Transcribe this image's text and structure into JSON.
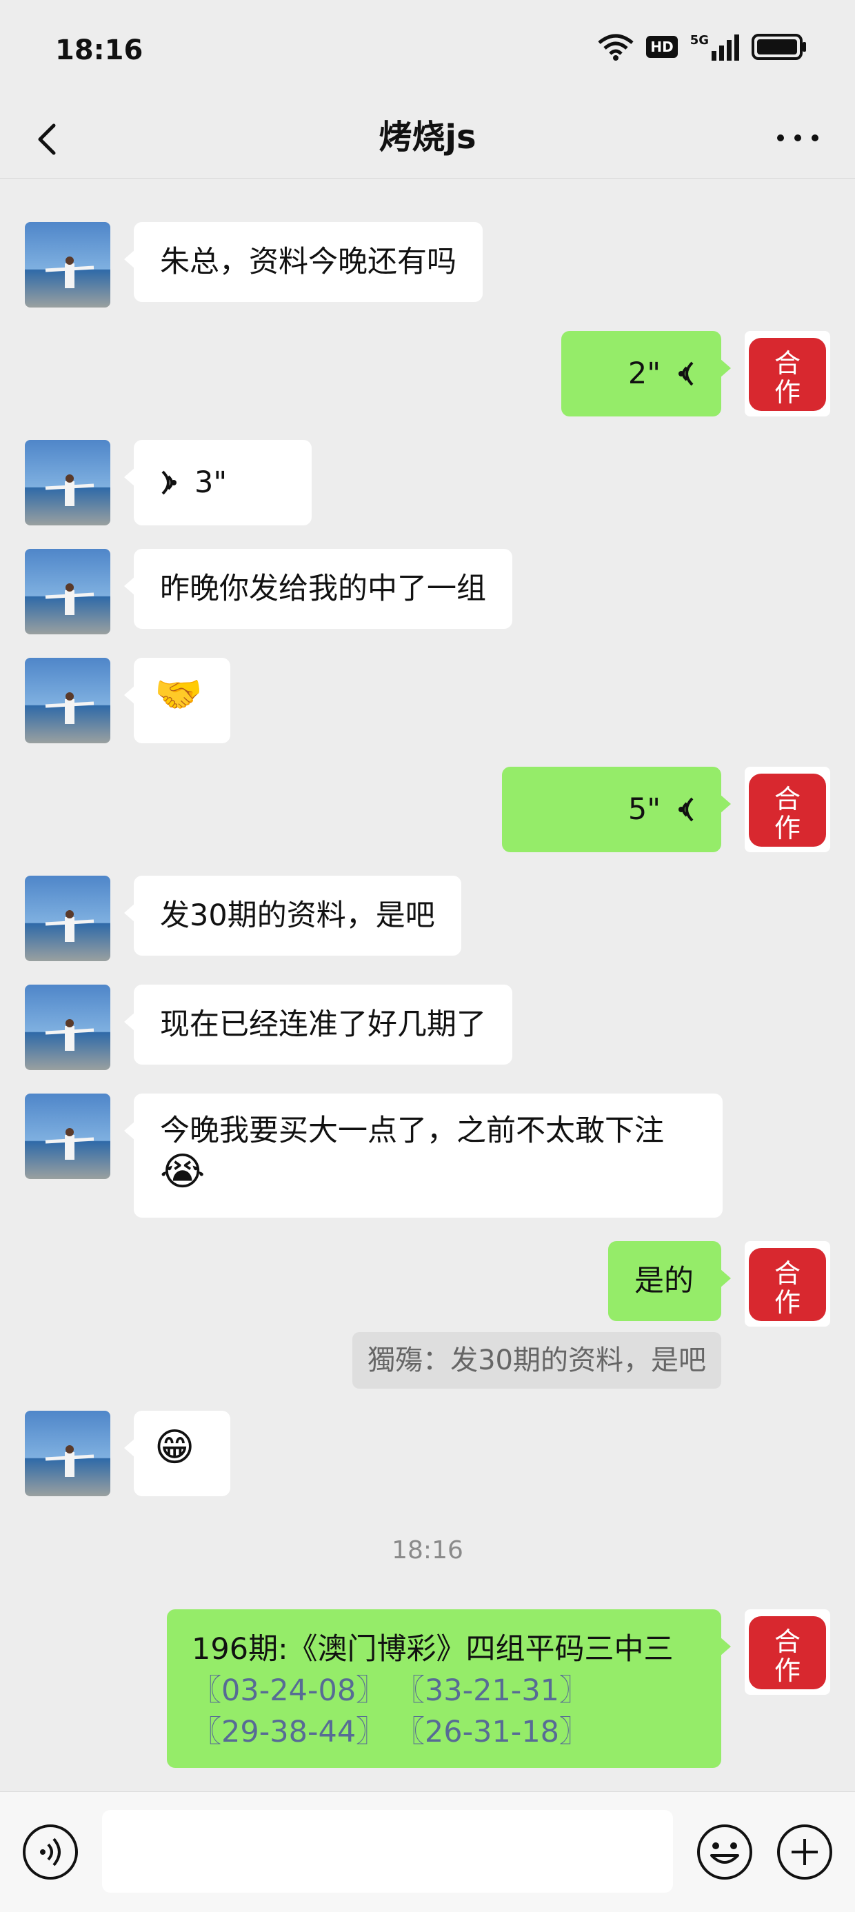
{
  "status_bar": {
    "time": "18:16",
    "hd": "HD",
    "net": "5G"
  },
  "header": {
    "title": "烤烧js",
    "back_icon": "chevron-left-icon",
    "more_icon": "more-dots-icon"
  },
  "messages": [
    {
      "side": "left",
      "type": "text",
      "text": "朱总，资料今晚还有吗"
    },
    {
      "side": "right",
      "type": "voice",
      "duration": "2\""
    },
    {
      "side": "left",
      "type": "voice",
      "duration": "3\""
    },
    {
      "side": "left",
      "type": "text",
      "text": "昨晚你发给我的中了一组"
    },
    {
      "side": "left",
      "type": "emoji",
      "emoji": "🤝"
    },
    {
      "side": "right",
      "type": "voice",
      "duration": "5\""
    },
    {
      "side": "left",
      "type": "text",
      "text": "发30期的资料，是吧"
    },
    {
      "side": "left",
      "type": "text",
      "text": "现在已经连准了好几期了"
    },
    {
      "side": "left",
      "type": "text",
      "text": "今晚我要买大一点了，之前不太敢下注",
      "emoji": "😭"
    },
    {
      "side": "right",
      "type": "text",
      "text": "是的"
    },
    {
      "type": "quote",
      "text": "獨殤：发30期的资料，是吧"
    },
    {
      "side": "left",
      "type": "emoji",
      "emoji": "😁"
    },
    {
      "type": "time",
      "text": "18:16"
    },
    {
      "side": "right",
      "type": "text",
      "line1": "196期:《澳门博彩》四组平码三中三",
      "links": [
        "〖03-24-08〗",
        "〖33-21-31〗",
        "〖29-38-44〗",
        "〖26-31-18〗"
      ]
    }
  ],
  "input_bar": {
    "voice_icon": "voice-toggle-icon",
    "emoji_icon": "smiley-icon",
    "plus_icon": "plus-icon"
  },
  "colors": {
    "bg": "#ededed",
    "bubble_self": "#95ec69",
    "bubble_other": "#ffffff",
    "link": "#576b95"
  }
}
